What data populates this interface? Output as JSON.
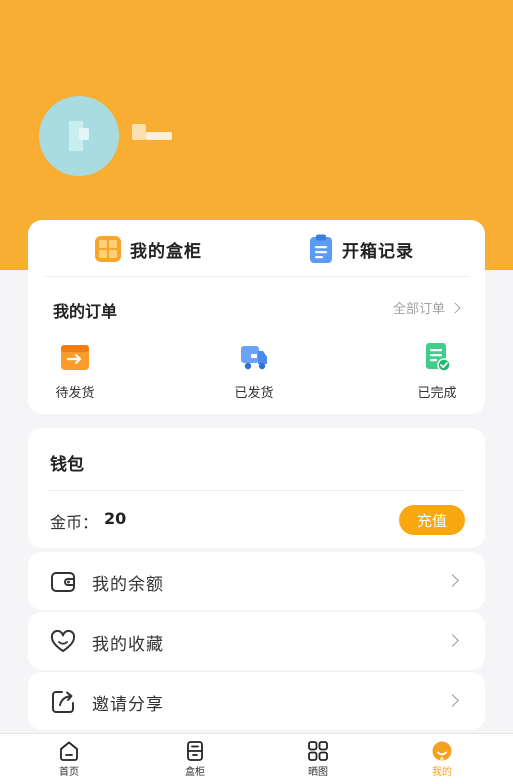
{
  "colors": {
    "hero": "#f7ae32",
    "accent": "#f8a70e",
    "card": "#ffffff",
    "background": "#f5f5f7"
  },
  "profile": {
    "avatar_icon": "avatar-placeholder",
    "username": ""
  },
  "quick_links": [
    {
      "label": "我的盒柜",
      "icon": "grid-box-icon"
    },
    {
      "label": "开箱记录",
      "icon": "clipboard-icon"
    }
  ],
  "orders": {
    "title": "我的订单",
    "all_label": "全部订单",
    "items": [
      {
        "label": "待发货",
        "icon": "pending-shipment-icon"
      },
      {
        "label": "已发货",
        "icon": "truck-icon"
      },
      {
        "label": "已完成",
        "icon": "completed-doc-icon"
      }
    ]
  },
  "wallet": {
    "title": "钱包",
    "coin_label": "金币：",
    "coin_value": "20",
    "recharge_label": "充值"
  },
  "menu": [
    {
      "label": "我的余额",
      "icon": "wallet-icon"
    },
    {
      "label": "我的收藏",
      "icon": "heart-icon"
    },
    {
      "label": "邀请分享",
      "icon": "share-icon"
    }
  ],
  "tabbar": [
    {
      "label": "首页",
      "icon": "home-icon"
    },
    {
      "label": "盒柜",
      "icon": "cabinet-icon"
    },
    {
      "label": "晒图",
      "icon": "gallery-icon"
    },
    {
      "label": "我的",
      "icon": "profile-icon",
      "active": true
    }
  ]
}
